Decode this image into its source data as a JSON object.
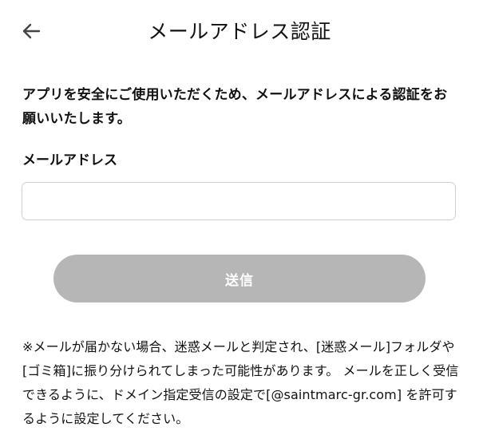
{
  "header": {
    "back_icon": "arrow-left-icon",
    "title": "メールアドレス認証"
  },
  "intro_text": "アプリを安全にご使用いただくため、メールアドレスによる認証をお願いいたします。",
  "email": {
    "label": "メールアドレス",
    "value": "",
    "placeholder": ""
  },
  "submit": {
    "label": "送信",
    "disabled_color": "#b6b6b6"
  },
  "note": "※メールが届かない場合、迷惑メールと判定され、[迷惑メール]フォルダや[ゴミ箱]に振り分けられてしまった可能性があります。 メールを正しく受信できるように、ドメイン指定受信の設定で[@saintmarc-gr.com] を許可するように設定してください。"
}
